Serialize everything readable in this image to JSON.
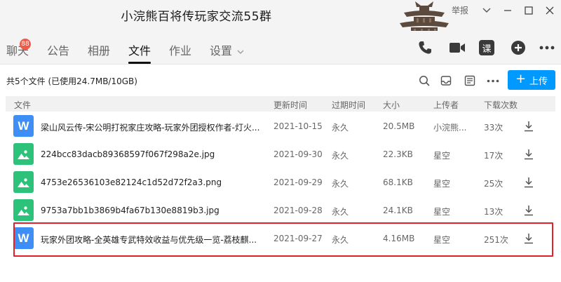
{
  "window": {
    "title": "小浣熊百将传玩家交流55群",
    "report_label": "举报"
  },
  "nav": {
    "tabs": [
      {
        "label": "聊天",
        "active": false
      },
      {
        "label": "公告",
        "active": false
      },
      {
        "label": "相册",
        "active": false
      },
      {
        "label": "文件",
        "active": true
      },
      {
        "label": "作业",
        "active": false
      },
      {
        "label": "设置",
        "active": false
      }
    ],
    "chat_badge": "88",
    "icons": [
      "phone-icon",
      "video-icon",
      "course-icon",
      "add-icon",
      "more-icon"
    ],
    "course_label": "课"
  },
  "toolbar": {
    "summary": "共5个文件 (已使用24.7MB/10GB)",
    "upload_label": "上传",
    "icons": [
      "search-icon",
      "inbox-icon",
      "folder-filter-icon",
      "more-icon"
    ]
  },
  "table": {
    "headers": {
      "file": "文件",
      "updated": "更新时间",
      "expires": "过期时间",
      "size": "大小",
      "uploader": "上传者",
      "downloads": "下载次数"
    },
    "rows": [
      {
        "type": "doc",
        "icon_text": "W",
        "name": "梁山风云传-宋公明打祝家庄攻略-玩家外团授权作者-灯火...",
        "updated": "2021-10-15",
        "expires": "永久",
        "size": "20.5MB",
        "uploader": "小浣熊...",
        "downloads": "33次"
      },
      {
        "type": "img",
        "icon_text": "",
        "name": "224bcc83dacb89368597f067f298a2e.jpg",
        "updated": "2021-09-30",
        "expires": "永久",
        "size": "22.3KB",
        "uploader": "星空",
        "downloads": "17次"
      },
      {
        "type": "img",
        "icon_text": "",
        "name": "4753e26536103e82124c1d52d72f2a3.png",
        "updated": "2021-09-29",
        "expires": "永久",
        "size": "68.1KB",
        "uploader": "星空",
        "downloads": "25次"
      },
      {
        "type": "img",
        "icon_text": "",
        "name": "9753a7bb1b3869b4fa67b130e8819b3.jpg",
        "updated": "2021-09-28",
        "expires": "永久",
        "size": "24.1KB",
        "uploader": "星空",
        "downloads": "13次"
      },
      {
        "type": "doc",
        "icon_text": "W",
        "name": "玩家外团攻略-全英雄专武特效收益与优先级一览-荔枝麒...",
        "updated": "2021-09-27",
        "expires": "永久",
        "size": "4.16MB",
        "uploader": "星空",
        "downloads": "251次"
      }
    ]
  },
  "colors": {
    "accent": "#0099ff",
    "doc_icon": "#3d8ff5",
    "img_icon": "#2cc27a",
    "badge": "#f15a4a",
    "highlight": "#e0202a"
  }
}
